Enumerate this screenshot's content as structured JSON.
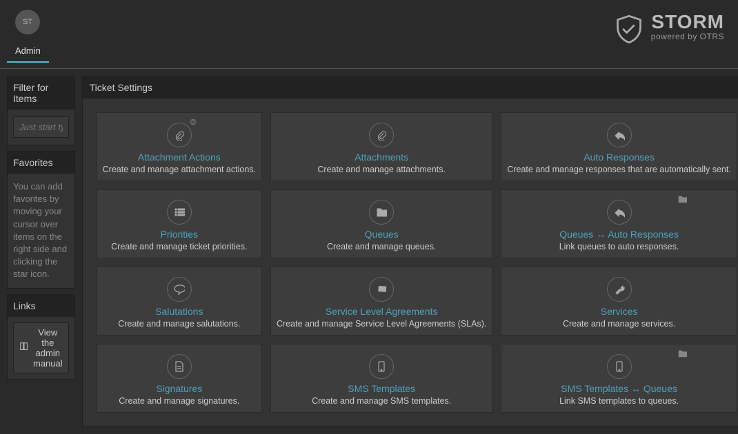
{
  "header": {
    "avatar": "ST",
    "tab": "Admin",
    "brand_name": "STORM",
    "brand_sub": "powered by OTRS"
  },
  "sidebar": {
    "filter": {
      "title": "Filter for Items",
      "placeholder": "Just start typing to filter..."
    },
    "favorites": {
      "title": "Favorites",
      "text": "You can add favorites by moving your cursor over items on the right side and clicking the star icon."
    },
    "links": {
      "title": "Links",
      "manual_label": "View the admin manual"
    }
  },
  "main": {
    "title": "Ticket Settings",
    "cards": [
      {
        "title": "Attachment Actions",
        "desc": "Create and manage attachment actions.",
        "icon": "attachment-icon",
        "gear": true
      },
      {
        "title": "Attachments",
        "desc": "Create and manage attachments.",
        "icon": "attachment-icon"
      },
      {
        "title": "Auto Responses",
        "desc": "Create and manage responses that are automatically sent.",
        "icon": "reply-icon"
      },
      {
        "title": "Priorities",
        "desc": "Create and manage ticket priorities.",
        "icon": "list-icon"
      },
      {
        "title": "Queues",
        "desc": "Create and manage queues.",
        "icon": "folder-icon"
      },
      {
        "title": "Queues ↔ Auto Responses",
        "desc": "Link queues to auto responses.",
        "icon": "reply-icon",
        "folder": true
      },
      {
        "title": "Salutations",
        "desc": "Create and manage salutations.",
        "icon": "chat-icon"
      },
      {
        "title": "Service Level Agreements",
        "desc": "Create and manage Service Level Agreements (SLAs).",
        "icon": "ticket-icon"
      },
      {
        "title": "Services",
        "desc": "Create and manage services.",
        "icon": "wrench-icon"
      },
      {
        "title": "Signatures",
        "desc": "Create and manage signatures.",
        "icon": "file-icon"
      },
      {
        "title": "SMS Templates",
        "desc": "Create and manage SMS templates.",
        "icon": "mobile-icon"
      },
      {
        "title": "SMS Templates ↔ Queues",
        "desc": "Link SMS templates to queues.",
        "icon": "mobile-icon",
        "folder": true
      }
    ]
  }
}
